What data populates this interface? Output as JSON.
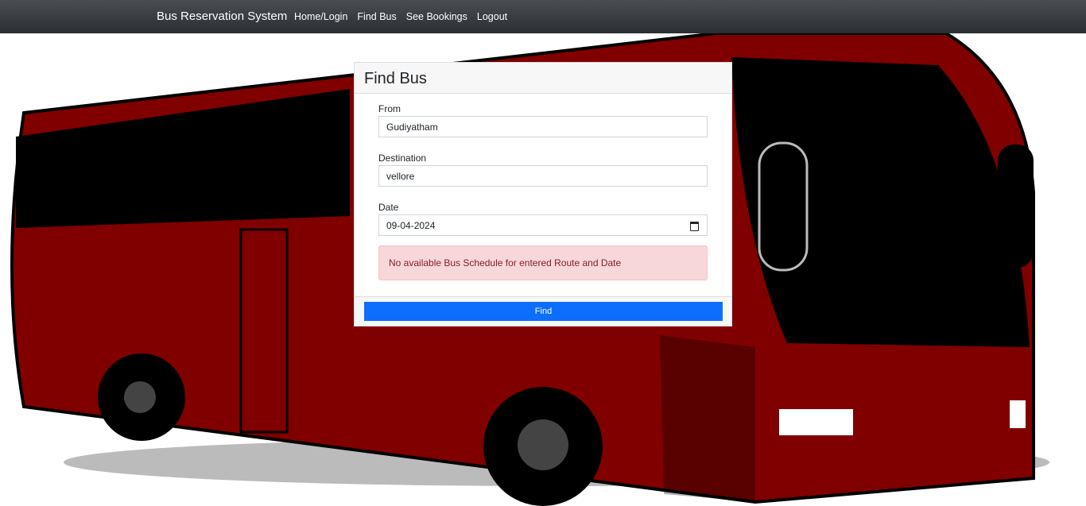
{
  "nav": {
    "brand": "Bus Reservation System",
    "links": [
      "Home/Login",
      "Find Bus",
      "See Bookings",
      "Logout"
    ]
  },
  "form": {
    "title": "Find Bus",
    "from_label": "From",
    "from_value": "Gudiyatham",
    "destination_label": "Destination",
    "destination_value": "vellore",
    "date_label": "Date",
    "date_value": "09-04-2024",
    "alert": "No available Bus Schedule for entered Route and Date",
    "find_label": "Find"
  },
  "colors": {
    "primary": "#0d6efd",
    "bus": "#800000",
    "alert_bg": "#f8d7da"
  }
}
